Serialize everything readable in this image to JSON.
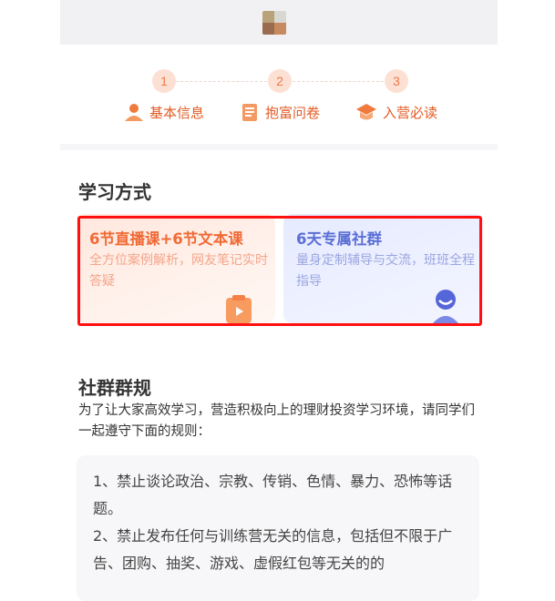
{
  "steps": [
    {
      "num": "1",
      "label": "基本信息",
      "icon": "user-icon"
    },
    {
      "num": "2",
      "label": "抱富问卷",
      "icon": "questionnaire-icon"
    },
    {
      "num": "3",
      "label": "入营必读",
      "icon": "graduation-cap-icon"
    }
  ],
  "learning": {
    "title": "学习方式",
    "cards": [
      {
        "title": "6节直播课+6节文本课",
        "subtitle": "全方位案例解析，网友笔记实时答疑",
        "icon": "video-board-icon"
      },
      {
        "title": "6天专属社群",
        "subtitle": "量身定制辅导与交流，班班全程指导",
        "icon": "tutor-avatar-icon"
      }
    ]
  },
  "community": {
    "title": "社群群规",
    "intro": "为了让大家高效学习，营造积极向上的理财投资学习环境，请同学们一起遵守下面的规则：",
    "rules": [
      "1、禁止谈论政治、宗教、传销、色情、暴力、恐怖等话题。",
      "2、禁止发布任何与训练营无关的信息，包括但不限于广告、团购、抽奖、游戏、虚假红包等无关的的"
    ]
  },
  "colors": {
    "accent": "#f06a35",
    "blue": "#5b6fd6",
    "highlight": "#ff1010"
  }
}
